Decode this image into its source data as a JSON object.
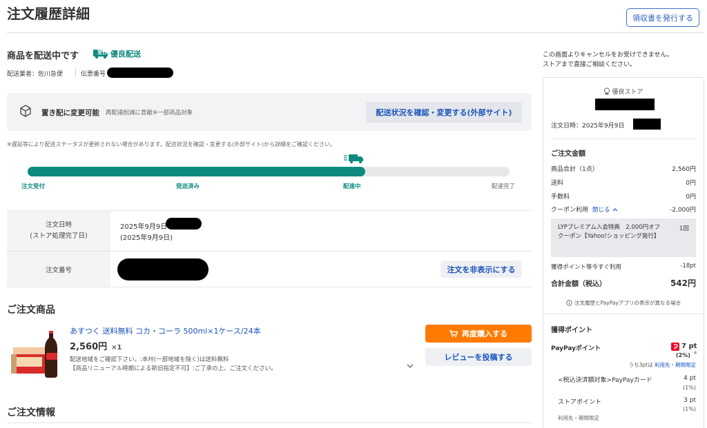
{
  "page": {
    "title": "注文履歴詳細",
    "receipt_button": "領収書を発行する"
  },
  "shipping": {
    "status_title": "商品を配送中です",
    "badge_text": "翌日",
    "badge_label": "優良配送",
    "carrier_label": "配送業者：佐川急便",
    "tracking_label": "伝票番号",
    "okihai_title": "置き配に変更可能",
    "okihai_note": "再配達削減に貢献※一部商品対象",
    "check_button": "配送状況を確認・変更する(外部サイト)",
    "notice": "※遅延等により配送ステータスが更新されない場合があります。配送状況を確認・変更する(外部サイト)から詳細をご確認ください。",
    "progress_value": 0.7,
    "steps": [
      "注文受付",
      "発送済み",
      "配達中",
      "配達完了"
    ]
  },
  "order_info": {
    "date_label": "注文日時",
    "date_sublabel": "(ストア処理完了日)",
    "date_value": "2025年9月9日",
    "date_sub_value": "(2025年9月9日)",
    "number_label": "注文番号",
    "hide_button": "注文を非表示にする"
  },
  "products": {
    "heading": "ご注文商品",
    "item": {
      "name": "あすつく 送料無料 コカ・コーラ 500ml×1ケース/24本",
      "price": "2,560円",
      "qty": "×1",
      "note1": "配送地域をご確認下さい。:本州(一部地域を除く)は送料無料",
      "note2": "【商品リニューアル時期による新旧指定不可】:ご了承の上、ご注文ください。"
    },
    "rebuy_button": "再度購入する",
    "review_button": "レビューを投稿する"
  },
  "order_details_heading": "ご注文情報",
  "sidebar": {
    "cancel_note1": "この画面よりキャンセルをお受けできません。",
    "cancel_note2": "ストアまで直接ご相談ください。",
    "store_badge": "優良ストア",
    "order_date": "注文日時：2025年9月9日",
    "amount_heading": "ご注文金額",
    "lines": [
      {
        "label": "商品合計（1点）",
        "value": "2,560円"
      },
      {
        "label": "送料",
        "value": "0円"
      },
      {
        "label": "手数料",
        "value": "0円"
      }
    ],
    "coupon_label": "クーポン利用",
    "coupon_toggle": "閉じる",
    "coupon_value": "-2,000円",
    "coupon_detail": "LYPプレミアム入会特典　2,000円オフクーポン【Yahoo!ショッピング発行】",
    "coupon_count": "1回",
    "points_used_label": "獲得ポイント等今すぐ利用",
    "points_used_value": "-18pt",
    "total_label": "合計金額（税込）",
    "total_value": "542円",
    "app_note": "注文履歴とPayPayアプリの表示が異なる場合",
    "points_heading": "獲得ポイント",
    "paypay_label": "PayPayポイント",
    "paypay_value": "7 pt",
    "paypay_pct": "(2%)",
    "paypay_mark": "※",
    "paypay_sub": "うち3ptは",
    "paypay_sub_link": "利用先・期間限定",
    "card_label": "<税込決済額対象>PayPayカード",
    "card_value": "4 pt",
    "card_pct": "(1%)",
    "store_point_label": "ストアポイント",
    "store_point_value": "3 pt",
    "store_point_pct": "(1%)",
    "store_point_sub": "利用先・期間限定"
  }
}
